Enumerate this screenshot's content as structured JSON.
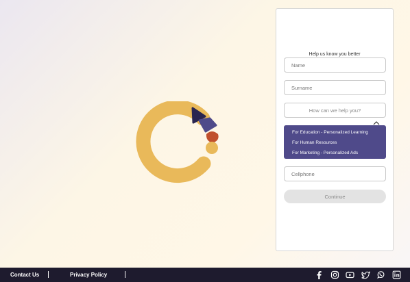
{
  "form": {
    "heading": "Help us know you better",
    "name_placeholder": "Name",
    "surname_placeholder": "Surname",
    "help_placeholder": "How can we help you?",
    "options": [
      "For Education - Personalized Learning",
      "For Human Resources",
      "For Marketing - Personalized Ads"
    ],
    "cellphone_placeholder": "Cellphone",
    "continue_label": "Continue"
  },
  "footer": {
    "contact_label": "Contact Us",
    "privacy_label": "Privacy Policy",
    "social_icons": [
      "facebook-icon",
      "instagram-icon",
      "youtube-icon",
      "twitter-icon",
      "whatsapp-icon",
      "linkedin-icon"
    ]
  },
  "colors": {
    "logo_yellow": "#e9b95a",
    "logo_navy": "#2a2550",
    "logo_purple": "#4f4a8a",
    "logo_rust": "#c0502d",
    "dropdown_bg": "#4f4a8a",
    "footer_bg": "#1e1b2e"
  }
}
